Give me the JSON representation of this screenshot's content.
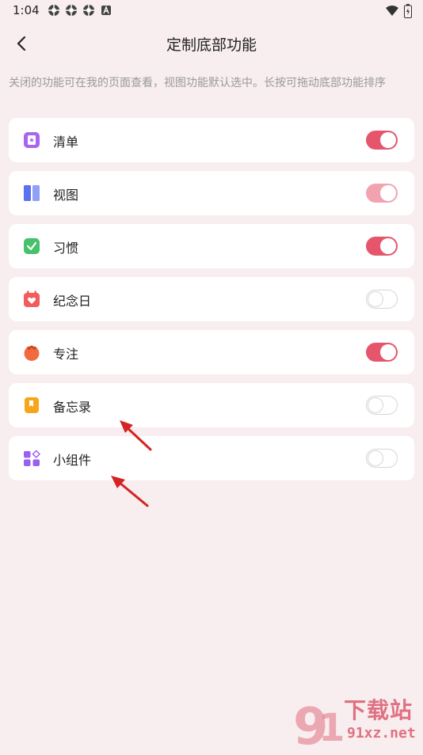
{
  "status_bar": {
    "time": "1:04",
    "left_icons": [
      "vpn-icon",
      "vpn-icon",
      "vpn-icon",
      "a-icon"
    ],
    "right_icons": [
      "wifi-icon",
      "battery-icon"
    ]
  },
  "header": {
    "title": "定制底部功能",
    "back_icon": "back-arrow-icon"
  },
  "hint": "关闭的功能可在我的页面查看，视图功能默认选中。长按可拖动底部功能排序",
  "items": [
    {
      "label": "清单",
      "icon": "checklist-icon",
      "state": "on",
      "color": "#a865f0"
    },
    {
      "label": "视图",
      "icon": "view-icon",
      "state": "on-disabled",
      "color": "#6b7ff5"
    },
    {
      "label": "习惯",
      "icon": "habit-icon",
      "state": "on",
      "color": "#46c26a"
    },
    {
      "label": "纪念日",
      "icon": "calendar-heart-icon",
      "state": "off",
      "color": "#f25c5c"
    },
    {
      "label": "专注",
      "icon": "tomato-icon",
      "state": "on",
      "color": "#f26b3f"
    },
    {
      "label": "备忘录",
      "icon": "memo-icon",
      "state": "off",
      "color": "#f7a51c"
    },
    {
      "label": "小组件",
      "icon": "widgets-icon",
      "state": "off",
      "color": "#9a60ef"
    }
  ],
  "colors": {
    "background": "#f8edef",
    "toggle_on": "#e5566d",
    "arrow": "#d42323"
  },
  "watermark": {
    "text": "下载站",
    "domain": "91xz.net"
  }
}
